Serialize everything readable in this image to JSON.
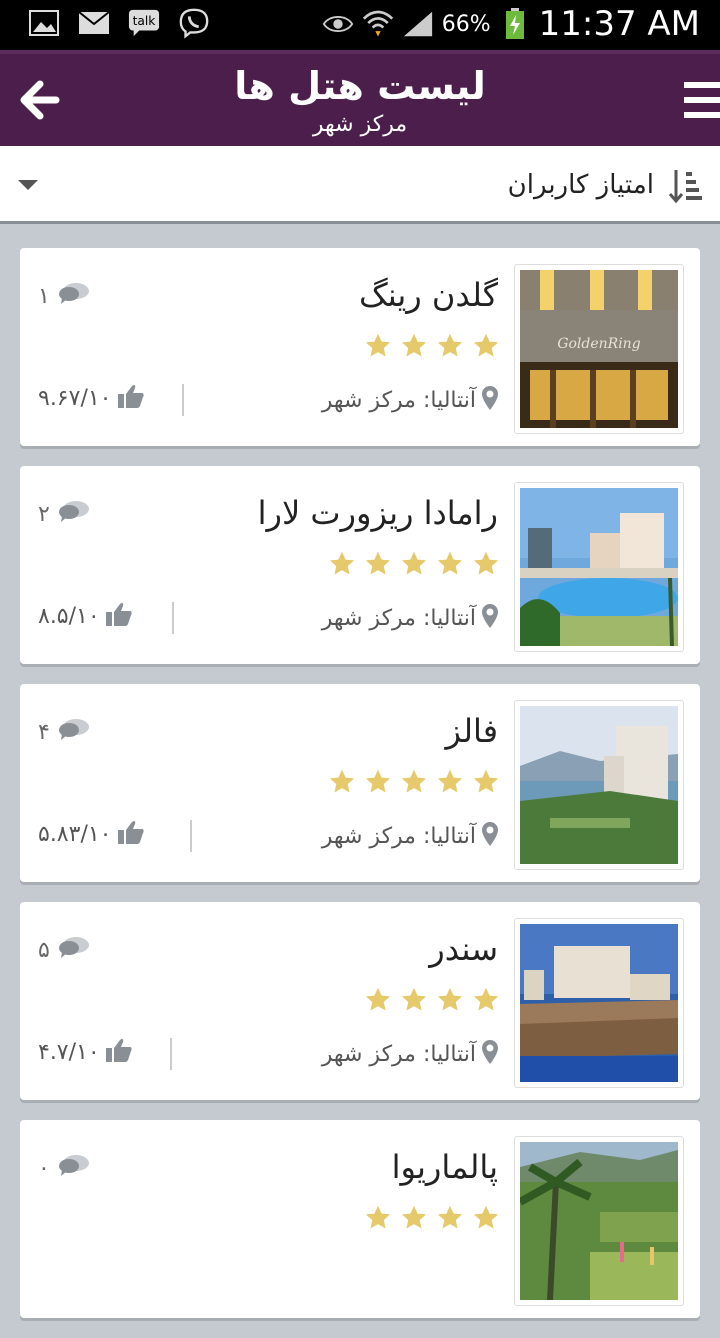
{
  "status": {
    "battery": "66%",
    "time": "11:37 AM",
    "icons_left": [
      "gallery-icon",
      "mail-icon",
      "talk-icon",
      "viber-icon"
    ],
    "icons_right": [
      "eye-icon",
      "wifi-icon",
      "signal-icon",
      "battery-icon"
    ]
  },
  "appbar": {
    "title": "لیست هتل ها",
    "subtitle": "مرکز شهر"
  },
  "sort": {
    "label": "امتیاز کاربران"
  },
  "hotels": [
    {
      "name": "گلدن رینگ",
      "stars": 4,
      "location": "آنتالیا: مرکز شهر",
      "rating": "۹.۶۷/۱۰",
      "comments": "۱"
    },
    {
      "name": "رامادا ریزورت لارا",
      "stars": 5,
      "location": "آنتالیا: مرکز شهر",
      "rating": "۸.۵/۱۰",
      "comments": "۲"
    },
    {
      "name": "فالز",
      "stars": 5,
      "location": "آنتالیا: مرکز شهر",
      "rating": "۵.۸۳/۱۰",
      "comments": "۴"
    },
    {
      "name": "سندر",
      "stars": 4,
      "location": "آنتالیا: مرکز شهر",
      "rating": "۴.۷/۱۰",
      "comments": "۵"
    },
    {
      "name": "پالماریوا",
      "stars": 4,
      "location": "",
      "rating": "",
      "comments": "۰"
    }
  ],
  "colors": {
    "appbar": "#4b1e4b",
    "star": "#e6c96a",
    "icon_gray": "#8a8f96"
  }
}
